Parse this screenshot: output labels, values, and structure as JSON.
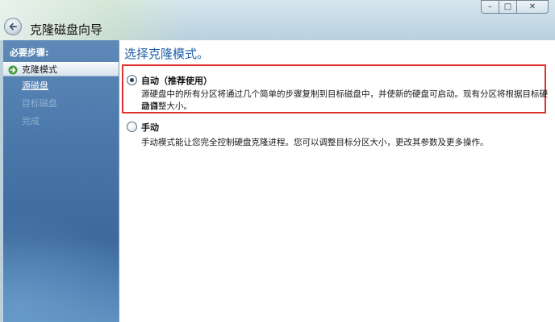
{
  "window": {
    "title": "克隆磁盘向导",
    "controls": {
      "minimize": "–",
      "maximize": "□",
      "close": "✕"
    }
  },
  "sidebar": {
    "heading": "必要步骤:",
    "items": [
      {
        "label": "克隆模式",
        "state": "active"
      },
      {
        "label": "源磁盘",
        "state": "link"
      },
      {
        "label": "目标磁盘",
        "state": "disabled"
      },
      {
        "label": "完成",
        "state": "disabled"
      }
    ]
  },
  "main": {
    "heading": "选择克隆模式。",
    "options": [
      {
        "label": "自动（推荐使用）",
        "selected": true,
        "description_line1": "源硬盘中的所有分区将通过几个简单的步骤复制到目标磁盘中，并使新的硬盘可启动。现有分区将根据目标硬盘自",
        "description_line2": "动调整大小。"
      },
      {
        "label": "手动",
        "selected": false,
        "description_line1": "手动模式能让您完全控制硬盘克隆进程。您可以调整目标分区大小，更改其参数及更多操作。"
      }
    ]
  },
  "colors": {
    "accent_heading": "#1f5fa8",
    "highlight_border": "#e0322c",
    "sidebar_blue": "#4a78ab"
  },
  "icons": {
    "back": "back-arrow-icon",
    "active_step": "green-arrow-icon"
  }
}
